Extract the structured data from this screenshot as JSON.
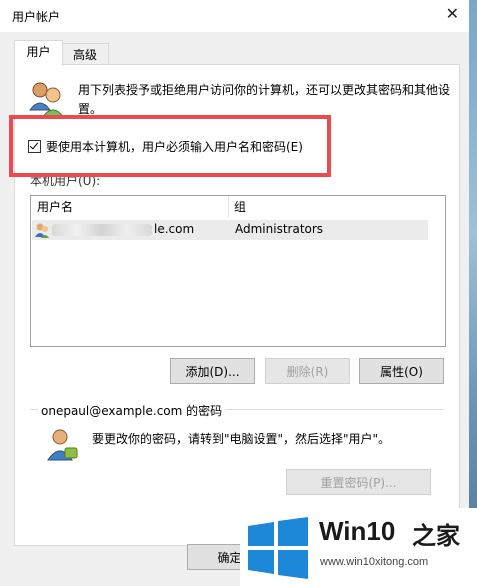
{
  "window": {
    "title": "用户帐户",
    "close_glyph": "✕"
  },
  "tabs": [
    {
      "label": "用户"
    },
    {
      "label": "高级"
    }
  ],
  "intro_text": "用下列表授予或拒绝用户访问你的计算机，还可以更改其密码和其他设置。",
  "require_login": {
    "label": "要使用本计算机，用户必须输入用户名和密码(E)",
    "checked": true
  },
  "users_label": "本机用户(U):",
  "table": {
    "headers": [
      "用户名",
      "组"
    ],
    "rows": [
      {
        "username_visible": "le.com",
        "group": "Administrators"
      }
    ]
  },
  "buttons": {
    "add": "添加(D)...",
    "remove": "删除(R)",
    "properties": "属性(O)",
    "reset_password": "重置密码(P)...",
    "ok": "确定"
  },
  "password_group": {
    "title": "onepaul@example.com 的密码",
    "text": "要更改你的密码，请转到\"电脑设置\"，然后选择\"用户\"。"
  },
  "watermark": {
    "brand": "Win10",
    "brand_cn": "之家",
    "url": "www.win10xitong.com"
  },
  "colors": {
    "highlight_box": "#ec4a4f",
    "logo_blue": "#1e88d8"
  }
}
